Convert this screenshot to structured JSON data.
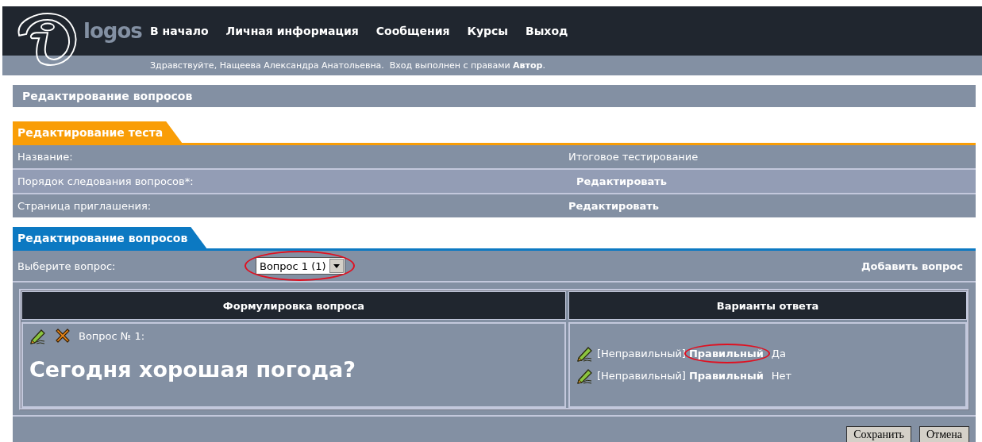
{
  "header": {
    "logo_text": "logos",
    "nav": [
      {
        "label": "В начало"
      },
      {
        "label": "Личная информация"
      },
      {
        "label": "Сообщения"
      },
      {
        "label": "Курсы"
      },
      {
        "label": "Выход"
      }
    ],
    "greeting": "Здравствуйте, Нащеева Александра Анатольевна.  Вход выполнен с правами **Автор**."
  },
  "page_title": "Редактирование вопросов",
  "test_section": {
    "tab": "Редактирование теста",
    "rows": [
      {
        "label": "Название:",
        "value": "Итоговое тестирование",
        "kind": "text"
      },
      {
        "label": "Порядок следования вопросов*:",
        "value": "Редактировать",
        "kind": "link"
      },
      {
        "label": "Страница приглашения:",
        "value": "Редактировать",
        "kind": "link"
      }
    ]
  },
  "questions_section": {
    "tab": "Редактирование вопросов",
    "select_label": "Выберите вопрос:",
    "question_select": {
      "value": "Вопрос 1 (1)",
      "highlighted": true
    },
    "add_link": "Добавить вопрос",
    "table": {
      "columns": [
        "Формулировка вопроса",
        "Варианты ответа"
      ],
      "question": {
        "number": "Вопрос № 1:",
        "text": "Сегодня хорошая погода?"
      },
      "answers": [
        {
          "wrong": "[Неправильный]",
          "right": "Правильный",
          "value": "Да",
          "highlighted": true
        },
        {
          "wrong": "[Неправильный]",
          "right": "Правильный",
          "value": "Нет",
          "highlighted": false
        }
      ]
    }
  },
  "buttons": [
    "Сохранить",
    "Отмена"
  ]
}
